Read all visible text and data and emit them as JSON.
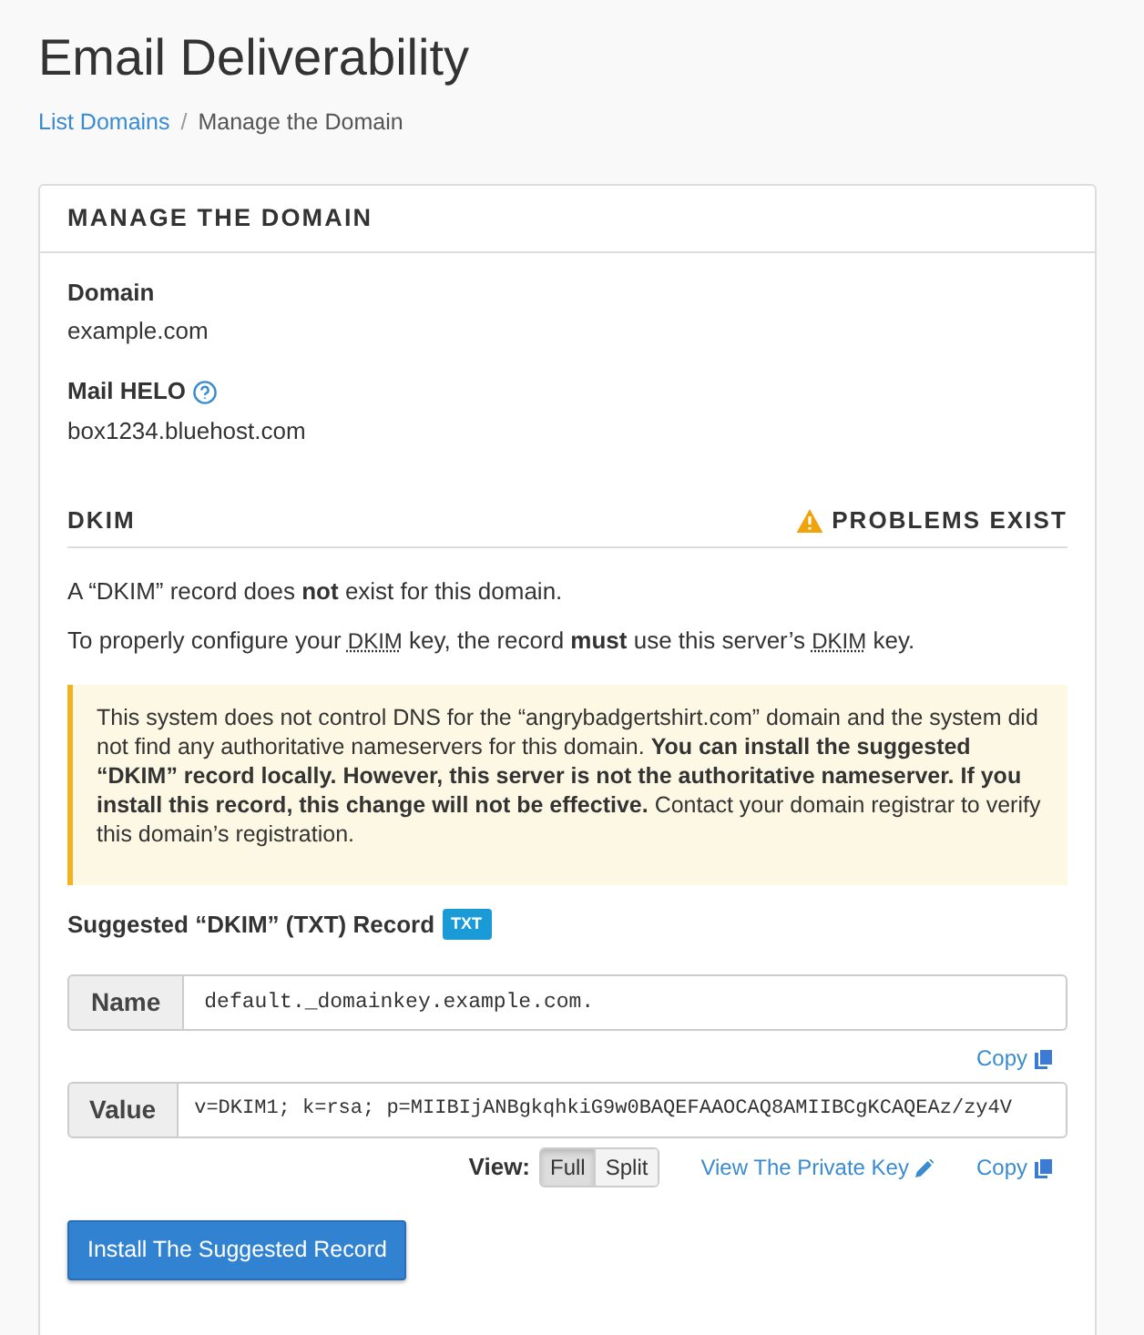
{
  "page_title": "Email Deliverability",
  "breadcrumb_separator": "/",
  "breadcrumb": [
    {
      "label": "List Domains",
      "kind": "link"
    },
    {
      "label": "Manage the Domain",
      "kind": "current"
    }
  ],
  "card": {
    "title": "MANAGE THE DOMAIN",
    "fields": [
      {
        "label": "Domain",
        "value": "example.com",
        "help": false
      },
      {
        "label": "Mail HELO",
        "value": "box1234.bluehost.com",
        "help": true
      }
    ],
    "dkim": {
      "title": "DKIM",
      "status": "PROBLEMS EXIST",
      "sentences": [
        [
          {
            "kind": "plain",
            "text": "A “DKIM” record does "
          },
          {
            "kind": "bold",
            "text": "not"
          },
          {
            "kind": "plain",
            "text": " exist for this domain."
          }
        ],
        [
          {
            "kind": "plain",
            "text": "To properly configure your "
          },
          {
            "kind": "abbr",
            "text": "DKIM"
          },
          {
            "kind": "plain",
            "text": " key, the record "
          },
          {
            "kind": "bold",
            "text": "must"
          },
          {
            "kind": "plain",
            "text": " use this server’s "
          },
          {
            "kind": "abbr",
            "text": "DKIM"
          },
          {
            "kind": "plain",
            "text": " key."
          }
        ]
      ],
      "alert": "This system does not control DNS for the “angrybadgertshirt.com” domain and the system did not find any authoritative nameservers for this domain. **You can install the suggested “DKIM” record locally. However, this server is not the authoritative nameserver. If you install this record, this change will not be effective.** Contact your domain registrar to verify this domain’s registration.",
      "record_title": "Suggested “DKIM” (TXT) Record",
      "record_badge": "TXT",
      "name_label": "Name",
      "name_value": "default._domainkey.example.com.",
      "name_copy": "Copy",
      "value_label": "Value",
      "value_value": "v=DKIM1; k=rsa; p=MIIBIjANBgkqhkiG9w0BAQEFAAOCAQ8AMIIBCgKCAQEAz/zy4V",
      "view_label": "View:",
      "view_options": [
        {
          "label": "Full",
          "selected": true
        },
        {
          "label": "Split",
          "selected": false
        }
      ],
      "private_key_link": "View The Private Key",
      "value_copy": "Copy",
      "install_button": "Install The Suggested Record"
    }
  }
}
